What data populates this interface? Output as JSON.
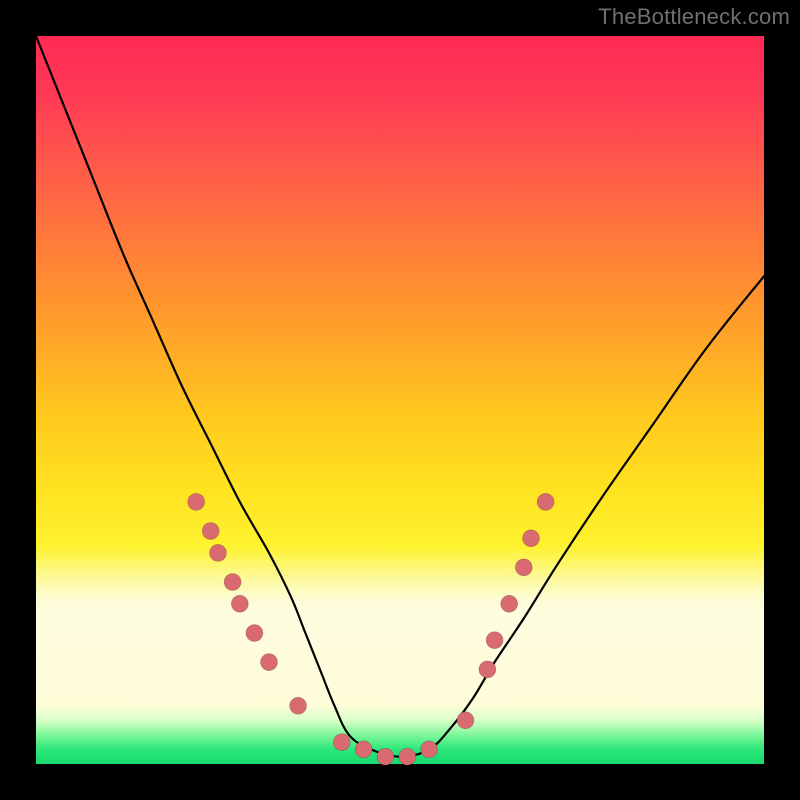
{
  "watermark": "TheBottleneck.com",
  "chart_data": {
    "type": "line",
    "title": "",
    "xlabel": "",
    "ylabel": "",
    "xlim": [
      0,
      100
    ],
    "ylim": [
      0,
      100
    ],
    "grid": false,
    "legend": false,
    "background_gradient": {
      "orientation": "vertical",
      "stops": [
        {
          "pos": 0.0,
          "color": "#ff2a55"
        },
        {
          "pos": 0.18,
          "color": "#ff5a4a"
        },
        {
          "pos": 0.4,
          "color": "#ffa02a"
        },
        {
          "pos": 0.62,
          "color": "#ffe220"
        },
        {
          "pos": 0.77,
          "color": "#fdfccf"
        },
        {
          "pos": 0.92,
          "color": "#fffcd8"
        },
        {
          "pos": 0.98,
          "color": "#2ce77a"
        },
        {
          "pos": 1.0,
          "color": "#18da6e"
        }
      ]
    },
    "series": [
      {
        "name": "bottleneck-curve",
        "x": [
          0,
          4,
          8,
          12,
          16,
          20,
          24,
          28,
          32,
          35,
          37,
          39,
          41,
          43,
          46,
          50,
          54,
          57,
          60,
          63,
          67,
          72,
          78,
          85,
          92,
          100
        ],
        "y": [
          100,
          90,
          80,
          70,
          61,
          52,
          44,
          36,
          29,
          23,
          18,
          13,
          8,
          4,
          2,
          1,
          2,
          5,
          9,
          14,
          20,
          28,
          37,
          47,
          57,
          67
        ]
      }
    ],
    "markers": {
      "name": "highlight-dots",
      "color": "#d96a6f",
      "points": [
        {
          "x": 22,
          "y": 36
        },
        {
          "x": 24,
          "y": 32
        },
        {
          "x": 25,
          "y": 29
        },
        {
          "x": 27,
          "y": 25
        },
        {
          "x": 28,
          "y": 22
        },
        {
          "x": 30,
          "y": 18
        },
        {
          "x": 32,
          "y": 14
        },
        {
          "x": 36,
          "y": 8
        },
        {
          "x": 42,
          "y": 3
        },
        {
          "x": 45,
          "y": 2
        },
        {
          "x": 48,
          "y": 1
        },
        {
          "x": 51,
          "y": 1
        },
        {
          "x": 54,
          "y": 2
        },
        {
          "x": 59,
          "y": 6
        },
        {
          "x": 62,
          "y": 13
        },
        {
          "x": 63,
          "y": 17
        },
        {
          "x": 65,
          "y": 22
        },
        {
          "x": 67,
          "y": 27
        },
        {
          "x": 68,
          "y": 31
        },
        {
          "x": 70,
          "y": 36
        }
      ]
    }
  }
}
